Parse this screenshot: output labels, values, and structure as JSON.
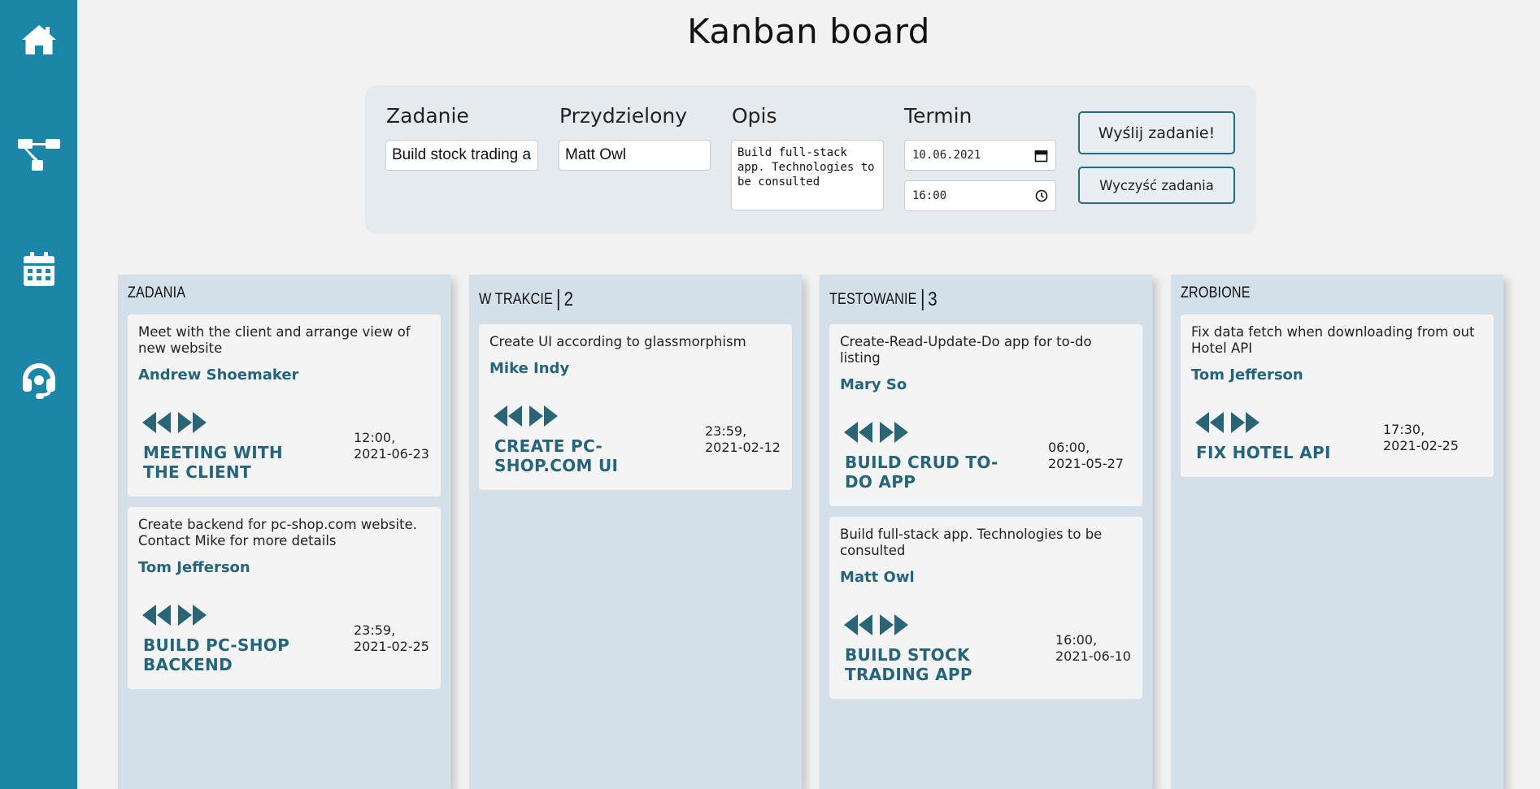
{
  "sidebar": {
    "items": [
      {
        "icon": "home-icon"
      },
      {
        "icon": "sitemap-icon"
      },
      {
        "icon": "calendar-icon"
      },
      {
        "icon": "headset-icon"
      }
    ],
    "color": "#1b87a8"
  },
  "page": {
    "title": "Kanban board"
  },
  "form": {
    "task_label": "Zadanie",
    "task_value": "Build stock trading a",
    "assignee_label": "Przydzielony",
    "assignee_value": "Matt Owl",
    "desc_label": "Opis",
    "desc_value": "Build full-stack app. Technologies to be consulted",
    "deadline_label": "Termin",
    "date_value": "10.06.2021",
    "time_value": "16:00",
    "submit_label": "Wyślij zadanie!",
    "clear_label": "Wyczyść zadania"
  },
  "columns": [
    {
      "title": "ZADANIA",
      "count": "",
      "cards": [
        {
          "desc": "Meet with the client and arrange view of new website",
          "person": "Andrew Shoemaker",
          "title": "MEETING WITH THE CLIENT",
          "date": "12:00, 2021-06-23"
        },
        {
          "desc": "Create backend for pc-shop.com website. Contact Mike for more details",
          "person": "Tom Jefferson",
          "title": "BUILD PC-SHOP BACKEND",
          "date": "23:59, 2021-02-25"
        }
      ]
    },
    {
      "title": "W TRAKCIE",
      "count": "2",
      "cards": [
        {
          "desc": "Create UI according to glassmorphism",
          "person": "Mike Indy",
          "title": "CREATE PC-SHOP.COM UI",
          "date": "23:59, 2021-02-12"
        }
      ]
    },
    {
      "title": "TESTOWANIE",
      "count": "3",
      "cards": [
        {
          "desc": "Create-Read-Update-Do app for to-do listing",
          "person": "Mary So",
          "title": "BUILD CRUD TO-DO APP",
          "date": "06:00, 2021-05-27"
        },
        {
          "desc": "Build full-stack app. Technologies to be consulted",
          "person": "Matt Owl",
          "title": "BUILD STOCK TRADING APP",
          "date": "16:00, 2021-06-10"
        }
      ]
    },
    {
      "title": "ZROBIONE",
      "count": "",
      "cards": [
        {
          "desc": "Fix data fetch when downloading from out Hotel API",
          "person": "Tom Jefferson",
          "title": "FIX HOTEL API",
          "date": "17:30, 2021-02-25"
        }
      ]
    }
  ]
}
